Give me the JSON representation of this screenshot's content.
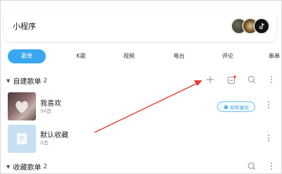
{
  "mini_program": {
    "title": "小程序"
  },
  "tabs": [
    {
      "label": "歌单",
      "active": true
    },
    {
      "label": "K歌",
      "active": false
    },
    {
      "label": "视频",
      "active": false
    },
    {
      "label": "电台",
      "active": false
    },
    {
      "label": "评论",
      "active": false
    },
    {
      "label": "串串",
      "active": false
    }
  ],
  "created_section": {
    "title": "自建歌单",
    "count": "2",
    "icons": [
      "add-icon",
      "import-icon",
      "search-icon",
      "more-icon"
    ],
    "playlists": [
      {
        "name": "我喜欢",
        "subtitle": "94首",
        "button_label": "聆听喜欢"
      },
      {
        "name": "默认收藏",
        "subtitle": "0首"
      }
    ]
  },
  "collected_section": {
    "title": "收藏歌单",
    "count": "2",
    "icons": [
      "search-icon",
      "more-icon"
    ]
  },
  "colors": {
    "accent": "#3aa8f0",
    "arrow": "#e53935",
    "badge": "#ff3b30"
  }
}
